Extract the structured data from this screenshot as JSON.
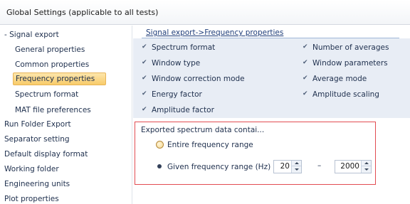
{
  "window": {
    "title": "Global Settings (applicable to all tests)"
  },
  "sidebar": {
    "items": [
      {
        "label": "- Signal export"
      },
      {
        "label": "General properties"
      },
      {
        "label": "Common properties"
      },
      {
        "label": "Frequency properties"
      },
      {
        "label": "Spectrum format"
      },
      {
        "label": "MAT file preferences"
      },
      {
        "label": "Run Folder Export"
      },
      {
        "label": "Separator setting"
      },
      {
        "label": "Default display format"
      },
      {
        "label": "Working folder"
      },
      {
        "label": "Engineering units"
      },
      {
        "label": "Plot properties"
      }
    ],
    "selected": "Frequency properties"
  },
  "main": {
    "breadcrumb": "Signal export->Frequency properties",
    "options": [
      {
        "label": "Spectrum format",
        "checked": true
      },
      {
        "label": "Number of averages",
        "checked": true
      },
      {
        "label": "Window type",
        "checked": true
      },
      {
        "label": "Window parameters",
        "checked": true
      },
      {
        "label": "Window correction mode",
        "checked": true
      },
      {
        "label": "Average mode",
        "checked": true
      },
      {
        "label": "Energy factor",
        "checked": true
      },
      {
        "label": "Amplitude scaling",
        "checked": true
      },
      {
        "label": "Amplitude factor",
        "checked": true
      }
    ],
    "export": {
      "heading": "Exported spectrum data contai...",
      "entire_label": "Entire frequency range",
      "given_label": "Given frequency range (Hz)",
      "selected": "given",
      "from": "20",
      "separator": "–",
      "to": "2000"
    }
  },
  "colors": {
    "selection_fill": "#f8cb6a",
    "highlight_border": "#e24c52",
    "panel_background": "#e8edf5"
  }
}
